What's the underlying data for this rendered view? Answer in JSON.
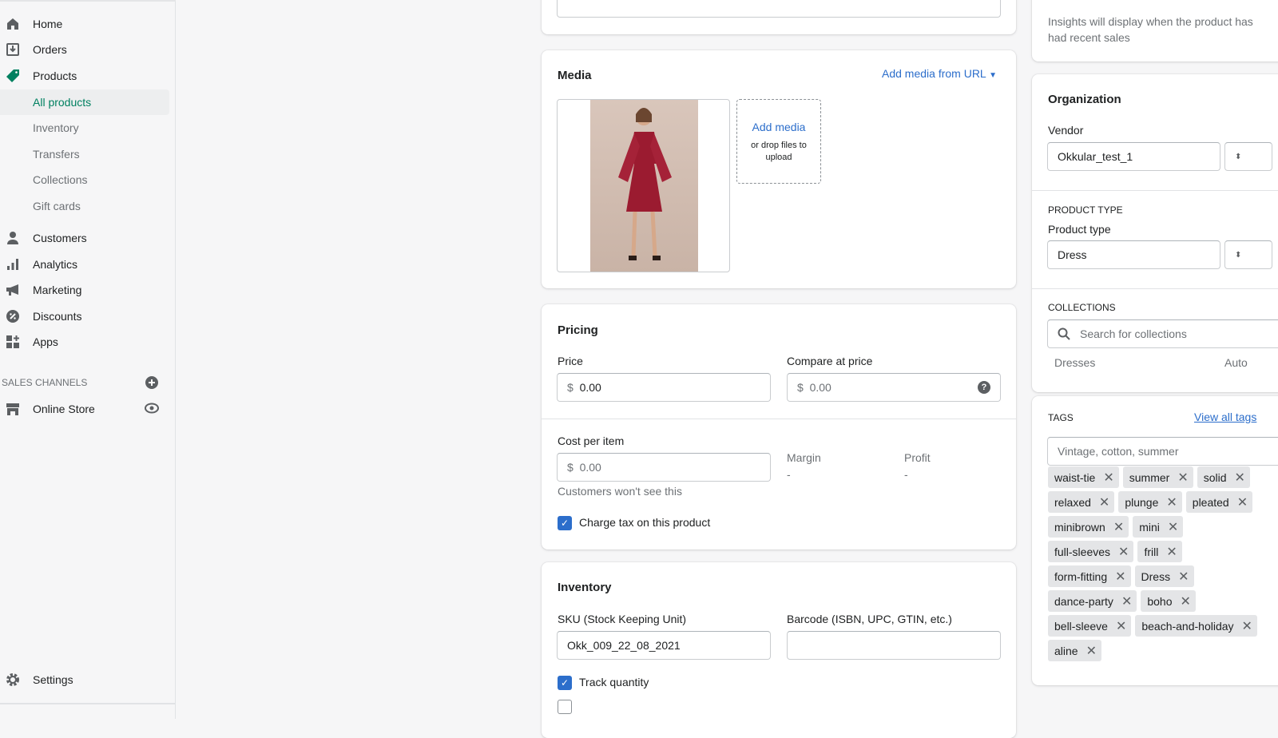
{
  "sidebar": {
    "items": [
      {
        "label": "Home",
        "icon": "home-icon"
      },
      {
        "label": "Orders",
        "icon": "orders-icon"
      },
      {
        "label": "Products",
        "icon": "tag-icon"
      }
    ],
    "sub_items": [
      {
        "label": "All products",
        "active": true
      },
      {
        "label": "Inventory"
      },
      {
        "label": "Transfers"
      },
      {
        "label": "Collections"
      },
      {
        "label": "Gift cards"
      }
    ],
    "items2": [
      {
        "label": "Customers",
        "icon": "customer-icon"
      },
      {
        "label": "Analytics",
        "icon": "analytics-icon"
      },
      {
        "label": "Marketing",
        "icon": "megaphone-icon"
      },
      {
        "label": "Discounts",
        "icon": "discount-icon"
      },
      {
        "label": "Apps",
        "icon": "apps-icon"
      }
    ],
    "sales_channels": "SALES CHANNELS",
    "online_store": "Online Store",
    "settings": "Settings"
  },
  "media": {
    "title": "Media",
    "add_url": "Add media from URL",
    "add_media": "Add media",
    "drop": "or drop files to upload"
  },
  "pricing": {
    "title": "Pricing",
    "price_label": "Price",
    "price": "0.00",
    "compare_label": "Compare at price",
    "compare": "0.00",
    "currency": "$",
    "cost_label": "Cost per item",
    "cost": "0.00",
    "margin_label": "Margin",
    "margin": "-",
    "profit_label": "Profit",
    "profit": "-",
    "hint": "Customers won't see this",
    "charge_tax": "Charge tax on this product"
  },
  "inventory": {
    "title": "Inventory",
    "sku_label": "SKU (Stock Keeping Unit)",
    "sku": "Okk_009_22_08_2021",
    "barcode_label": "Barcode (ISBN, UPC, GTIN, etc.)",
    "barcode": "",
    "track": "Track quantity"
  },
  "insights": {
    "text": "Insights will display when the product has had recent sales"
  },
  "organization": {
    "title": "Organization",
    "vendor_label": "Vendor",
    "vendor": "Okkular_test_1",
    "product_type_heading": "PRODUCT TYPE",
    "product_type_label": "Product type",
    "product_type": "Dress",
    "collections_heading": "COLLECTIONS",
    "collections_placeholder": "Search for collections",
    "collection": "Dresses",
    "collection_type": "Auto"
  },
  "tags": {
    "heading": "TAGS",
    "view_all": "View all tags",
    "placeholder": "Vintage, cotton, summer",
    "items": [
      "waist-tie",
      "summer",
      "solid",
      "relaxed",
      "plunge",
      "pleated",
      "minibrown",
      "mini",
      "full-sleeves",
      "frill",
      "form-fitting",
      "Dress",
      "dance-party",
      "boho",
      "bell-sleeve",
      "beach-and-holiday",
      "aline"
    ]
  },
  "colors": {
    "accent": "#008060",
    "link": "#2c6ecb",
    "dress": "#9b1b30"
  }
}
